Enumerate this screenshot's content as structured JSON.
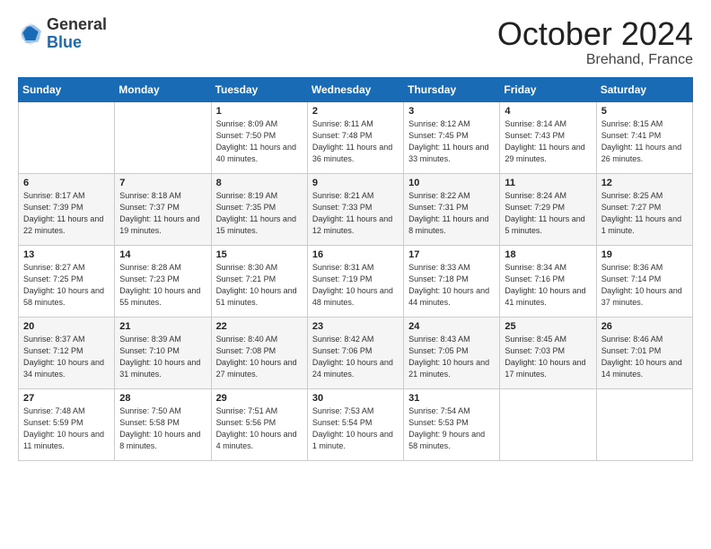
{
  "header": {
    "logo_general": "General",
    "logo_blue": "Blue",
    "month_title": "October 2024",
    "location": "Brehand, France"
  },
  "days_of_week": [
    "Sunday",
    "Monday",
    "Tuesday",
    "Wednesday",
    "Thursday",
    "Friday",
    "Saturday"
  ],
  "weeks": [
    [
      {
        "day": "",
        "sunrise": "",
        "sunset": "",
        "daylight": ""
      },
      {
        "day": "",
        "sunrise": "",
        "sunset": "",
        "daylight": ""
      },
      {
        "day": "1",
        "sunrise": "Sunrise: 8:09 AM",
        "sunset": "Sunset: 7:50 PM",
        "daylight": "Daylight: 11 hours and 40 minutes."
      },
      {
        "day": "2",
        "sunrise": "Sunrise: 8:11 AM",
        "sunset": "Sunset: 7:48 PM",
        "daylight": "Daylight: 11 hours and 36 minutes."
      },
      {
        "day": "3",
        "sunrise": "Sunrise: 8:12 AM",
        "sunset": "Sunset: 7:45 PM",
        "daylight": "Daylight: 11 hours and 33 minutes."
      },
      {
        "day": "4",
        "sunrise": "Sunrise: 8:14 AM",
        "sunset": "Sunset: 7:43 PM",
        "daylight": "Daylight: 11 hours and 29 minutes."
      },
      {
        "day": "5",
        "sunrise": "Sunrise: 8:15 AM",
        "sunset": "Sunset: 7:41 PM",
        "daylight": "Daylight: 11 hours and 26 minutes."
      }
    ],
    [
      {
        "day": "6",
        "sunrise": "Sunrise: 8:17 AM",
        "sunset": "Sunset: 7:39 PM",
        "daylight": "Daylight: 11 hours and 22 minutes."
      },
      {
        "day": "7",
        "sunrise": "Sunrise: 8:18 AM",
        "sunset": "Sunset: 7:37 PM",
        "daylight": "Daylight: 11 hours and 19 minutes."
      },
      {
        "day": "8",
        "sunrise": "Sunrise: 8:19 AM",
        "sunset": "Sunset: 7:35 PM",
        "daylight": "Daylight: 11 hours and 15 minutes."
      },
      {
        "day": "9",
        "sunrise": "Sunrise: 8:21 AM",
        "sunset": "Sunset: 7:33 PM",
        "daylight": "Daylight: 11 hours and 12 minutes."
      },
      {
        "day": "10",
        "sunrise": "Sunrise: 8:22 AM",
        "sunset": "Sunset: 7:31 PM",
        "daylight": "Daylight: 11 hours and 8 minutes."
      },
      {
        "day": "11",
        "sunrise": "Sunrise: 8:24 AM",
        "sunset": "Sunset: 7:29 PM",
        "daylight": "Daylight: 11 hours and 5 minutes."
      },
      {
        "day": "12",
        "sunrise": "Sunrise: 8:25 AM",
        "sunset": "Sunset: 7:27 PM",
        "daylight": "Daylight: 11 hours and 1 minute."
      }
    ],
    [
      {
        "day": "13",
        "sunrise": "Sunrise: 8:27 AM",
        "sunset": "Sunset: 7:25 PM",
        "daylight": "Daylight: 10 hours and 58 minutes."
      },
      {
        "day": "14",
        "sunrise": "Sunrise: 8:28 AM",
        "sunset": "Sunset: 7:23 PM",
        "daylight": "Daylight: 10 hours and 55 minutes."
      },
      {
        "day": "15",
        "sunrise": "Sunrise: 8:30 AM",
        "sunset": "Sunset: 7:21 PM",
        "daylight": "Daylight: 10 hours and 51 minutes."
      },
      {
        "day": "16",
        "sunrise": "Sunrise: 8:31 AM",
        "sunset": "Sunset: 7:19 PM",
        "daylight": "Daylight: 10 hours and 48 minutes."
      },
      {
        "day": "17",
        "sunrise": "Sunrise: 8:33 AM",
        "sunset": "Sunset: 7:18 PM",
        "daylight": "Daylight: 10 hours and 44 minutes."
      },
      {
        "day": "18",
        "sunrise": "Sunrise: 8:34 AM",
        "sunset": "Sunset: 7:16 PM",
        "daylight": "Daylight: 10 hours and 41 minutes."
      },
      {
        "day": "19",
        "sunrise": "Sunrise: 8:36 AM",
        "sunset": "Sunset: 7:14 PM",
        "daylight": "Daylight: 10 hours and 37 minutes."
      }
    ],
    [
      {
        "day": "20",
        "sunrise": "Sunrise: 8:37 AM",
        "sunset": "Sunset: 7:12 PM",
        "daylight": "Daylight: 10 hours and 34 minutes."
      },
      {
        "day": "21",
        "sunrise": "Sunrise: 8:39 AM",
        "sunset": "Sunset: 7:10 PM",
        "daylight": "Daylight: 10 hours and 31 minutes."
      },
      {
        "day": "22",
        "sunrise": "Sunrise: 8:40 AM",
        "sunset": "Sunset: 7:08 PM",
        "daylight": "Daylight: 10 hours and 27 minutes."
      },
      {
        "day": "23",
        "sunrise": "Sunrise: 8:42 AM",
        "sunset": "Sunset: 7:06 PM",
        "daylight": "Daylight: 10 hours and 24 minutes."
      },
      {
        "day": "24",
        "sunrise": "Sunrise: 8:43 AM",
        "sunset": "Sunset: 7:05 PM",
        "daylight": "Daylight: 10 hours and 21 minutes."
      },
      {
        "day": "25",
        "sunrise": "Sunrise: 8:45 AM",
        "sunset": "Sunset: 7:03 PM",
        "daylight": "Daylight: 10 hours and 17 minutes."
      },
      {
        "day": "26",
        "sunrise": "Sunrise: 8:46 AM",
        "sunset": "Sunset: 7:01 PM",
        "daylight": "Daylight: 10 hours and 14 minutes."
      }
    ],
    [
      {
        "day": "27",
        "sunrise": "Sunrise: 7:48 AM",
        "sunset": "Sunset: 5:59 PM",
        "daylight": "Daylight: 10 hours and 11 minutes."
      },
      {
        "day": "28",
        "sunrise": "Sunrise: 7:50 AM",
        "sunset": "Sunset: 5:58 PM",
        "daylight": "Daylight: 10 hours and 8 minutes."
      },
      {
        "day": "29",
        "sunrise": "Sunrise: 7:51 AM",
        "sunset": "Sunset: 5:56 PM",
        "daylight": "Daylight: 10 hours and 4 minutes."
      },
      {
        "day": "30",
        "sunrise": "Sunrise: 7:53 AM",
        "sunset": "Sunset: 5:54 PM",
        "daylight": "Daylight: 10 hours and 1 minute."
      },
      {
        "day": "31",
        "sunrise": "Sunrise: 7:54 AM",
        "sunset": "Sunset: 5:53 PM",
        "daylight": "Daylight: 9 hours and 58 minutes."
      },
      {
        "day": "",
        "sunrise": "",
        "sunset": "",
        "daylight": ""
      },
      {
        "day": "",
        "sunrise": "",
        "sunset": "",
        "daylight": ""
      }
    ]
  ]
}
